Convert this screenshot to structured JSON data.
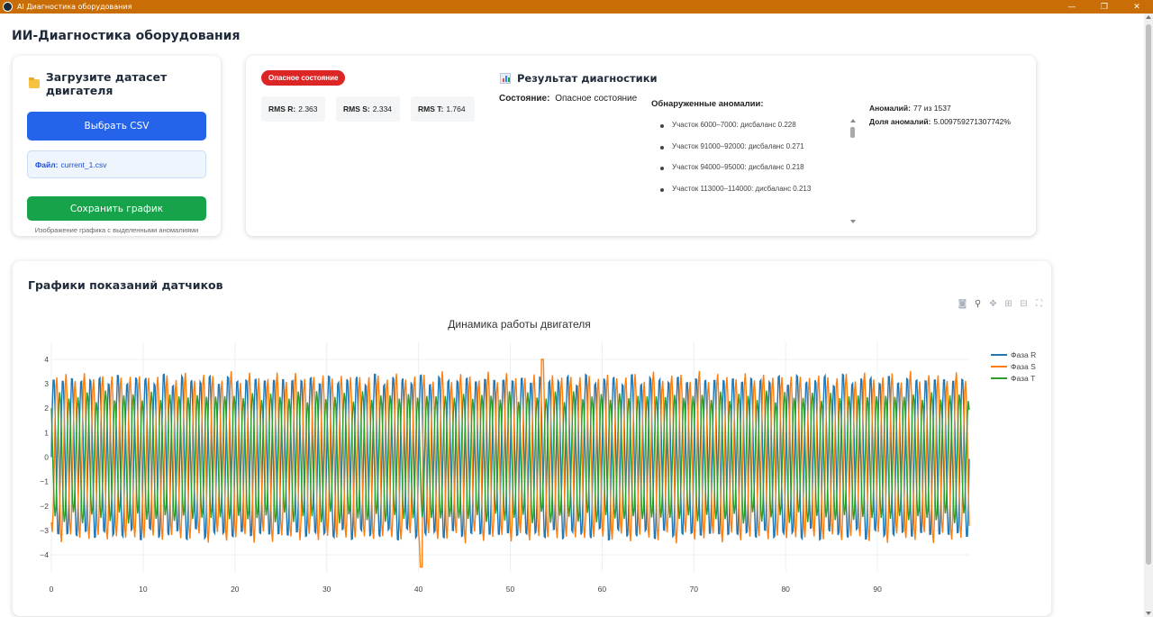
{
  "window": {
    "title": "AI Диагностика оборудования",
    "controls": [
      "—",
      "❐",
      "✕"
    ]
  },
  "page_title": "ИИ-Диагностика оборудования",
  "upload": {
    "title": "Загрузите датасет двигателя",
    "choose_button": "Выбрать CSV",
    "file_label": "Файл:",
    "file_name": "current_1.csv",
    "save_button": "Сохранить график",
    "save_caption": "Изображение графика с выделенными аномалиями"
  },
  "diagnostics": {
    "badge": "Опасное состояние",
    "badge_color": "#dc2626",
    "rms": [
      {
        "label": "RMS R:",
        "value": "2.363"
      },
      {
        "label": "RMS S:",
        "value": "2.334"
      },
      {
        "label": "RMS T:",
        "value": "1.764"
      }
    ],
    "result_title": "Результат диагностики",
    "state_label": "Состояние:",
    "state_value": "Опасное состояние",
    "anomalies_title": "Обнаруженные аномалии:",
    "anomalies": [
      "Участок 6000–7000: дисбаланс 0.228",
      "Участок 91000–92000: дисбаланс 0.271",
      "Участок 94000–95000: дисбаланс 0.218",
      "Участок 113000–114000: дисбаланс 0.213"
    ],
    "anomaly_count_label": "Аномалий:",
    "anomaly_count_value": "77 из 1537",
    "anomaly_share_label": "Доля аномалий:",
    "anomaly_share_value": "5.009759271307742%"
  },
  "chart_section": {
    "title": "Графики показаний датчиков",
    "modebar_icons": [
      "camera-icon",
      "zoom-icon",
      "pan-icon",
      "zoom-in-icon",
      "zoom-out-icon",
      "autoscale-icon"
    ]
  },
  "chart_data": {
    "type": "line",
    "title": "Динамика работы двигателя",
    "xlabel": "",
    "ylabel": "",
    "xlim": [
      0,
      100
    ],
    "ylim": [
      -4.7,
      4.7
    ],
    "x_ticks": [
      0,
      10,
      20,
      30,
      40,
      50,
      60,
      70,
      80,
      90
    ],
    "y_ticks": [
      4,
      3,
      2,
      1,
      0,
      -1,
      -2,
      -3,
      -4
    ],
    "grid": true,
    "legend_position": "top-right",
    "cycles": 100,
    "series": [
      {
        "name": "Фаза R",
        "color": "#1f77b4",
        "amplitude": 3.3,
        "phase_deg": 0
      },
      {
        "name": "Фаза S",
        "color": "#ff7f0e",
        "amplitude": 3.3,
        "phase_deg": -120
      },
      {
        "name": "Фаза T",
        "color": "#2ca02c",
        "amplitude": 2.5,
        "phase_deg": 120
      }
    ],
    "annotations": [
      {
        "series": "Фаза S",
        "x": 53.5,
        "y": 4.0
      },
      {
        "series": "Фаза S",
        "x": 40.3,
        "y": -4.5
      }
    ]
  }
}
